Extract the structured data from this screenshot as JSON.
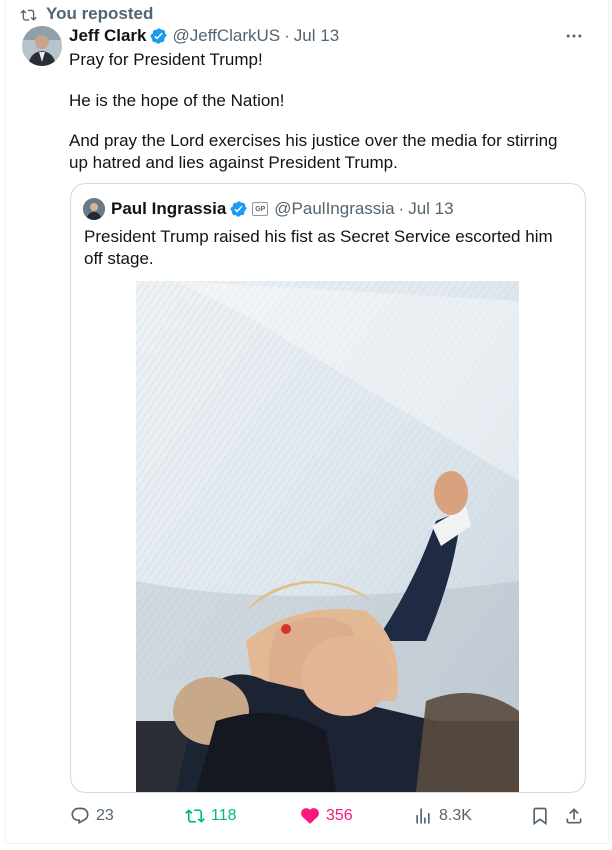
{
  "repost": {
    "label": "You reposted",
    "icon": "repost-icon"
  },
  "post": {
    "author_name": "Jeff Clark",
    "handle": "@JeffClarkUS",
    "separator": "·",
    "date": "Jul 13",
    "verified": true,
    "paragraphs": [
      "Pray for President Trump!",
      "He is the hope of the Nation!",
      "And pray the Lord exercises his justice over the media for stirring up hatred and lies against President Trump."
    ]
  },
  "quote": {
    "author_name": "Paul Ingrassia",
    "affiliation_badge": "GP",
    "handle": "@PaulIngrassia",
    "separator": "·",
    "date": "Jul 13",
    "verified": true,
    "text": "President Trump raised his fist as Secret Service escorted him off stage."
  },
  "actions": {
    "replies": "23",
    "reposts": "118",
    "likes": "356",
    "views": "8.3K"
  },
  "colors": {
    "verified": "#1d9bf0",
    "repost_active": "#00ba7c",
    "like_active": "#f91880",
    "secondary_text": "#536471",
    "border": "#cfd9de"
  }
}
